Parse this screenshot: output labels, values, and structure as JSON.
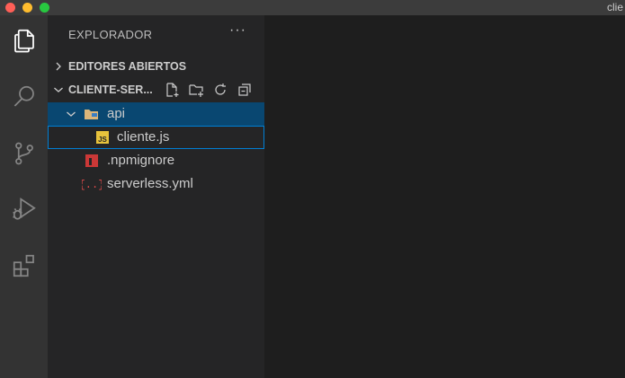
{
  "window": {
    "title": "clie"
  },
  "activity_bar": {
    "items": [
      {
        "icon": "files-icon"
      },
      {
        "icon": "search-icon"
      },
      {
        "icon": "source-control-icon"
      },
      {
        "icon": "run-debug-icon"
      },
      {
        "icon": "extensions-icon"
      }
    ]
  },
  "sidebar": {
    "title": "EXPLORADOR",
    "more": "···",
    "open_editors": {
      "label": "EDITORES ABIERTOS"
    },
    "folder": {
      "label": "CLIENTE-SER..."
    },
    "tree": {
      "api": "api",
      "cliente": "cliente.js",
      "npmignore": ".npmignore",
      "serverless": "serverless.yml"
    }
  },
  "colors": {
    "selected_row": "#094771",
    "focus_border": "#007fd4",
    "js_badge": "#e8c33c",
    "npm_red": "#cb3837",
    "yaml_red": "#e34c4c"
  }
}
